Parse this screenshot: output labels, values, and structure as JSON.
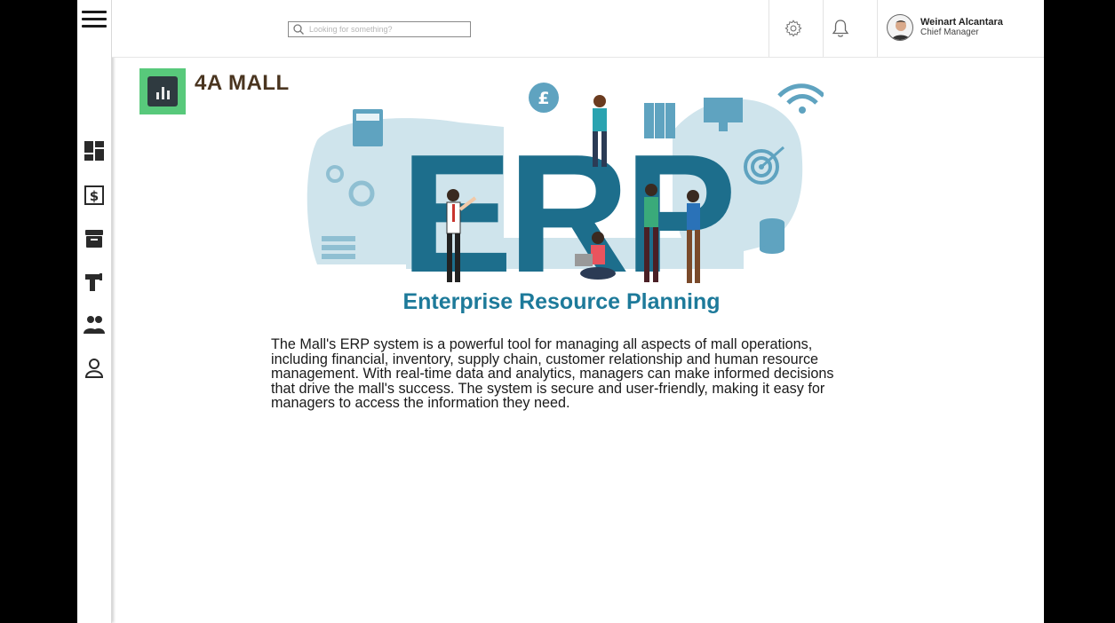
{
  "header": {
    "search_placeholder": "Looking for something?",
    "user": {
      "name": "Weinart Alcantara",
      "role": "Chief Manager"
    }
  },
  "sidebar": {
    "items": [
      {
        "icon": "dashboard-icon"
      },
      {
        "icon": "billing-icon"
      },
      {
        "icon": "archive-icon"
      },
      {
        "icon": "tools-icon"
      },
      {
        "icon": "group-icon"
      },
      {
        "icon": "user-icon"
      }
    ]
  },
  "brand": {
    "name": "4A MALL",
    "accent": "#58c97b"
  },
  "hero": {
    "erp_text": "ERP",
    "subtitle": "Enterprise Resource Planning",
    "currency_symbol": "£"
  },
  "description": "The Mall's ERP system is a powerful tool for managing all aspects of mall operations, including financial, inventory, supply chain, customer relationship and human resource management. With real-time data and analytics, managers can make informed decisions that drive the mall's success. The system is secure and user-friendly, making it easy for managers to access the information they need.",
  "colors": {
    "teal_dark": "#1d6e8c",
    "teal_light": "#cfe4ec",
    "text": "#1a1a1a"
  }
}
